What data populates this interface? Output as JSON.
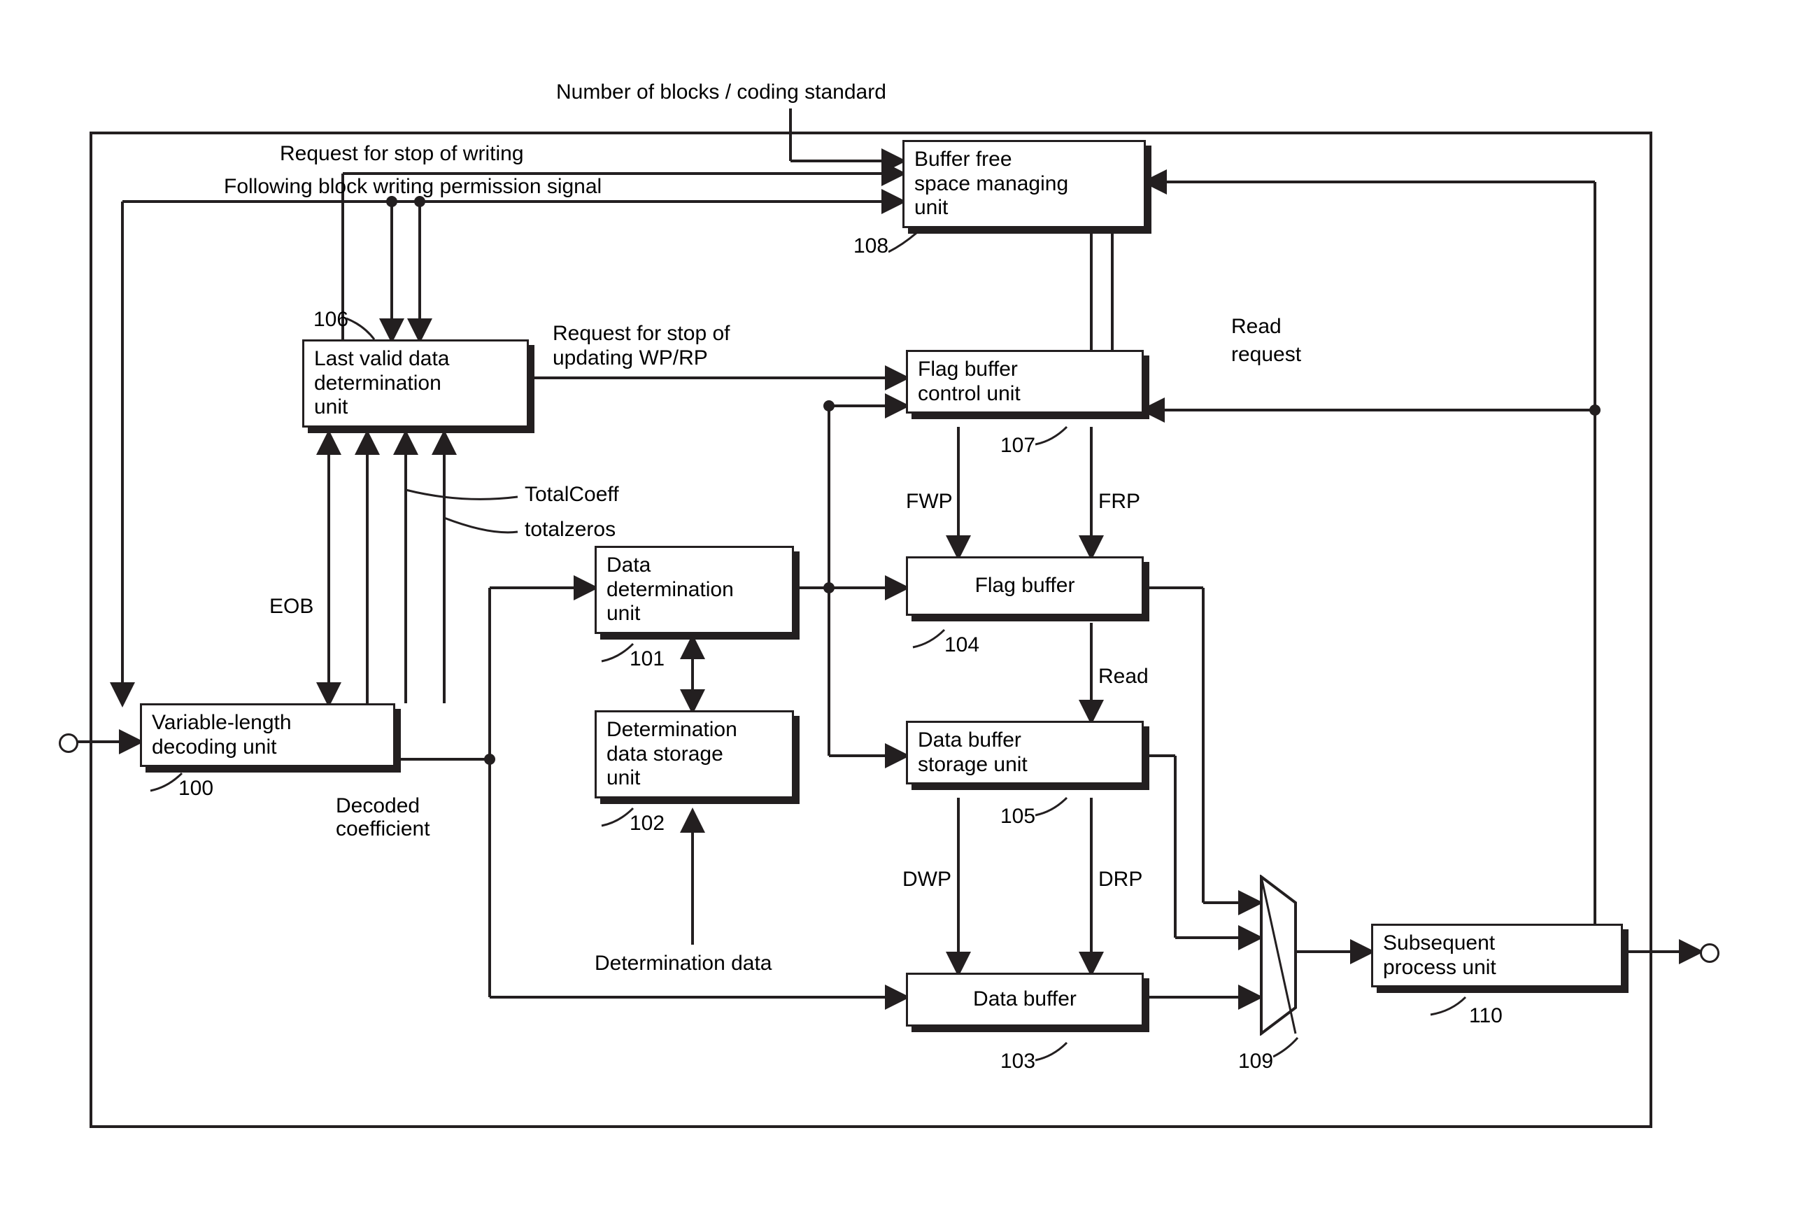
{
  "blocks": {
    "vld": {
      "l1": "Variable-length",
      "l2": "decoding unit",
      "ref": "100"
    },
    "ddet": {
      "l1": "Data",
      "l2": "determination",
      "l3": "unit",
      "ref": "101"
    },
    "dstor": {
      "l1": "Determination",
      "l2": "data storage",
      "l3": "unit",
      "ref": "102"
    },
    "dbuf": {
      "l1": "Data buffer",
      "ref": "103"
    },
    "fbuf": {
      "l1": "Flag buffer",
      "ref": "104"
    },
    "dbsu": {
      "l1": "Data buffer",
      "l2": "storage unit",
      "ref": "105"
    },
    "lvdu": {
      "l1": "Last valid data",
      "l2": "determination",
      "l3": "unit",
      "ref": "106"
    },
    "fbcu": {
      "l1": "Flag buffer",
      "l2": "control unit",
      "ref": "107"
    },
    "bfsmu": {
      "l1": "Buffer free",
      "l2": "space managing",
      "l3": "unit",
      "ref": "108"
    },
    "mux": {
      "ref": "109"
    },
    "spu": {
      "l1": "Subsequent",
      "l2": "process unit",
      "ref": "110"
    }
  },
  "labels": {
    "top1": "Number of blocks / coding standard",
    "top2": "Request for stop of writing",
    "top3": "Following block writing permission signal",
    "req_wp_rp": "Request for stop of updating WP/RP",
    "totalcoeff": "TotalCoeff",
    "totalzeros": "totalzeros",
    "eob": "EOB",
    "decoded_coef": "Decoded coefficient",
    "det_data": "Determination data",
    "fwp": "FWP",
    "frp": "FRP",
    "dwp": "DWP",
    "drp": "DRP",
    "read": "Read",
    "read_req1": "Read",
    "read_req2": "request"
  }
}
